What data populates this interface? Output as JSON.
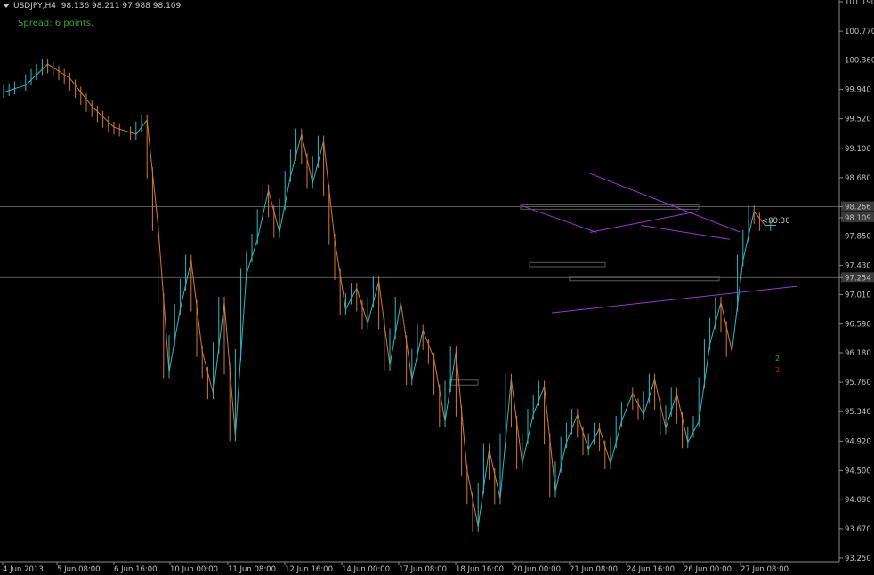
{
  "header": {
    "symbol_label": "USDJPY,H4",
    "ohlc": "98.136 98.211 97.988 98.109",
    "spread": "Spread: 6 points."
  },
  "countdown": "<80:30",
  "marker_up": "2",
  "marker_down": "2",
  "colors": {
    "background": "#000000",
    "axis": "#c0c0c0",
    "bull_bar": "#2fb8c0",
    "bear_bar": "#d07a33",
    "trendline": "#9b34d8",
    "level_line": "#5a5a5a",
    "spread_text": "#2eaa2e"
  },
  "chart_data": {
    "type": "line",
    "title": "USDJPY,H4",
    "ylim": [
      93.25,
      101.19
    ],
    "y_ticks": [
      "101.190",
      "100.770",
      "100.360",
      "99.940",
      "99.520",
      "99.100",
      "98.680",
      "98.266",
      "98.109",
      "97.850",
      "97.430",
      "97.254",
      "97.010",
      "96.590",
      "96.180",
      "95.760",
      "95.340",
      "94.920",
      "94.500",
      "94.090",
      "93.670",
      "93.250"
    ],
    "y_tick_values": [
      101.19,
      100.77,
      100.36,
      99.94,
      99.52,
      99.1,
      98.68,
      98.266,
      98.109,
      97.85,
      97.43,
      97.254,
      97.01,
      96.59,
      96.18,
      95.76,
      95.34,
      94.92,
      94.5,
      94.09,
      93.67,
      93.25
    ],
    "x_ticks": [
      "4 Jun 2013",
      "5 Jun 08:00",
      "6 Jun 16:00",
      "10 Jun 00:00",
      "11 Jun 08:00",
      "12 Jun 16:00",
      "14 Jun 00:00",
      "17 Jun 08:00",
      "18 Jun 16:00",
      "20 Jun 00:00",
      "21 Jun 08:00",
      "24 Jun 16:00",
      "26 Jun 00:00",
      "27 Jun 08:00"
    ],
    "bar_count": 140,
    "price_path": [
      [
        0,
        99.9
      ],
      [
        4,
        100.0
      ],
      [
        8,
        100.3
      ],
      [
        12,
        100.1
      ],
      [
        16,
        99.7
      ],
      [
        20,
        99.4
      ],
      [
        24,
        99.3
      ],
      [
        26,
        99.5
      ],
      [
        28,
        98.0
      ],
      [
        30,
        95.9
      ],
      [
        32,
        96.8
      ],
      [
        34,
        97.5
      ],
      [
        36,
        96.2
      ],
      [
        38,
        95.6
      ],
      [
        40,
        96.9
      ],
      [
        42,
        95.0
      ],
      [
        44,
        97.3
      ],
      [
        46,
        97.8
      ],
      [
        48,
        98.5
      ],
      [
        50,
        97.9
      ],
      [
        52,
        98.7
      ],
      [
        54,
        99.3
      ],
      [
        56,
        98.6
      ],
      [
        58,
        99.2
      ],
      [
        60,
        97.8
      ],
      [
        62,
        96.8
      ],
      [
        64,
        97.1
      ],
      [
        66,
        96.6
      ],
      [
        68,
        97.2
      ],
      [
        70,
        96.0
      ],
      [
        72,
        96.9
      ],
      [
        74,
        95.8
      ],
      [
        76,
        96.5
      ],
      [
        78,
        96.1
      ],
      [
        80,
        95.2
      ],
      [
        82,
        96.2
      ],
      [
        84,
        94.5
      ],
      [
        86,
        93.7
      ],
      [
        88,
        94.8
      ],
      [
        90,
        94.1
      ],
      [
        92,
        95.8
      ],
      [
        94,
        94.6
      ],
      [
        96,
        95.3
      ],
      [
        98,
        95.7
      ],
      [
        100,
        94.2
      ],
      [
        102,
        94.9
      ],
      [
        104,
        95.3
      ],
      [
        106,
        94.8
      ],
      [
        108,
        95.1
      ],
      [
        110,
        94.6
      ],
      [
        112,
        95.2
      ],
      [
        114,
        95.6
      ],
      [
        116,
        95.3
      ],
      [
        118,
        95.8
      ],
      [
        120,
        95.1
      ],
      [
        122,
        95.6
      ],
      [
        124,
        94.9
      ],
      [
        126,
        95.2
      ],
      [
        128,
        96.3
      ],
      [
        130,
        96.9
      ],
      [
        132,
        96.2
      ],
      [
        134,
        97.5
      ],
      [
        136,
        98.2
      ],
      [
        138,
        98.0
      ]
    ],
    "levels": [
      98.266,
      98.109,
      97.254
    ],
    "trendlines": [
      {
        "from": [
          663,
          97.9
        ],
        "to": [
          784,
          98.2
        ]
      },
      {
        "from": [
          586,
          98.28
        ],
        "to": [
          670,
          97.9
        ]
      },
      {
        "from": [
          663,
          98.74
        ],
        "to": [
          832,
          97.9
        ]
      },
      {
        "from": [
          720,
          98.0
        ],
        "to": [
          820,
          97.8
        ]
      },
      {
        "from": [
          620,
          96.75
        ],
        "to": [
          896,
          97.13
        ]
      }
    ],
    "grid": false,
    "legend": "none"
  }
}
